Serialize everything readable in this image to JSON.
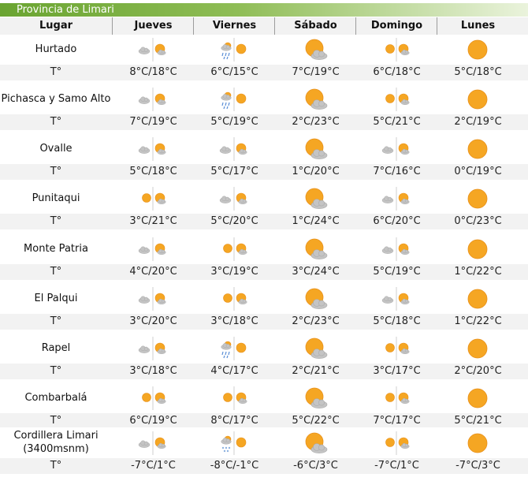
{
  "province": "Provincia de Limari",
  "headers": [
    "Lugar",
    "Jueves",
    "Viernes",
    "Sábado",
    "Domingo",
    "Lunes"
  ],
  "temp_label": "T°",
  "rows": [
    {
      "place": "Hurtado",
      "icons": [
        "cloud-sun-small",
        "rain-sun",
        "sun-cloud-large",
        "sun-sun",
        "sun-large"
      ],
      "temps": [
        "8°C/18°C",
        "6°C/15°C",
        "7°C/19°C",
        "6°C/18°C",
        "5°C/18°C"
      ]
    },
    {
      "place": "Pichasca y Samo Alto",
      "icons": [
        "cloud-sun-small",
        "rain-sun",
        "sun-cloud-large",
        "sun-sun",
        "sun-large"
      ],
      "temps": [
        "7°C/19°C",
        "5°C/19°C",
        "2°C/23°C",
        "5°C/21°C",
        "2°C/19°C"
      ]
    },
    {
      "place": "Ovalle",
      "icons": [
        "cloud-sun-small",
        "cloud-sun-small",
        "sun-cloud-large",
        "cloud-sun-small",
        "sun-large"
      ],
      "temps": [
        "5°C/18°C",
        "5°C/17°C",
        "1°C/20°C",
        "7°C/16°C",
        "0°C/19°C"
      ]
    },
    {
      "place": "Punitaqui",
      "icons": [
        "sun-sun",
        "cloud-sun-small",
        "sun-cloud-large",
        "cloud-sun-small",
        "sun-large"
      ],
      "temps": [
        "3°C/21°C",
        "5°C/20°C",
        "1°C/24°C",
        "6°C/20°C",
        "0°C/23°C"
      ]
    },
    {
      "place": "Monte Patria",
      "icons": [
        "cloud-sun-small",
        "sun-sun",
        "sun-cloud-large",
        "cloud-sun-small",
        "sun-large"
      ],
      "temps": [
        "4°C/20°C",
        "3°C/19°C",
        "3°C/24°C",
        "5°C/19°C",
        "1°C/22°C"
      ]
    },
    {
      "place": "El Palqui",
      "icons": [
        "cloud-sun-small",
        "sun-sun",
        "sun-cloud-large",
        "cloud-sun-small",
        "sun-large"
      ],
      "temps": [
        "3°C/20°C",
        "3°C/18°C",
        "2°C/23°C",
        "5°C/18°C",
        "1°C/22°C"
      ]
    },
    {
      "place": "Rapel",
      "icons": [
        "cloud-sun-small",
        "rain-sun",
        "sun-cloud-large",
        "sun-sun",
        "sun-large"
      ],
      "temps": [
        "3°C/18°C",
        "4°C/17°C",
        "2°C/21°C",
        "3°C/17°C",
        "2°C/20°C"
      ]
    },
    {
      "place": "Combarbalá",
      "icons": [
        "sun-sun",
        "sun-sun",
        "sun-cloud-large",
        "sun-sun",
        "sun-large"
      ],
      "temps": [
        "6°C/19°C",
        "8°C/17°C",
        "5°C/22°C",
        "7°C/17°C",
        "5°C/21°C"
      ]
    },
    {
      "place": "Cordillera Limari (3400msnm)",
      "place_line1": "Cordillera Limari",
      "place_line2": "(3400msnm)",
      "icons": [
        "cloud-sun-small",
        "snow-sun",
        "sun-cloud-large",
        "sun-sun",
        "sun-large"
      ],
      "temps": [
        "-7°C/1°C",
        "-8°C/-1°C",
        "-6°C/3°C",
        "-7°C/1°C",
        "-7°C/3°C"
      ]
    }
  ],
  "colors": {
    "header_bar": "#6aa431",
    "sun": "#f5a623",
    "cloud": "#b8b8b8",
    "stripe": "#f2f2f2"
  }
}
